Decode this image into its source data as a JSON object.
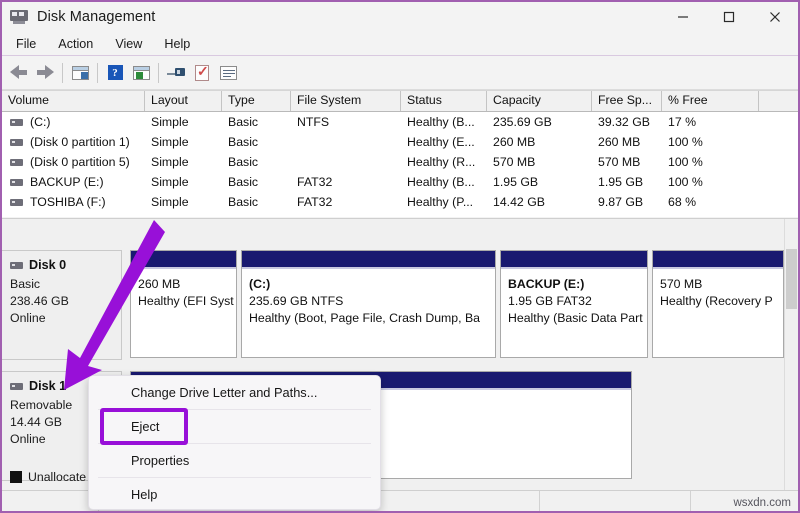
{
  "window": {
    "title": "Disk Management",
    "icon": "disk-management-icon",
    "controls": {
      "minimize": "minimize-icon",
      "maximize": "maximize-icon",
      "close": "close-icon"
    }
  },
  "menubar": {
    "items": [
      "File",
      "Action",
      "View",
      "Help"
    ]
  },
  "toolbar": {
    "buttons": [
      {
        "name": "back-icon"
      },
      {
        "name": "forward-icon"
      },
      {
        "name": "show-hide-console-tree-icon"
      },
      {
        "name": "help-icon"
      },
      {
        "name": "properties-window-icon"
      },
      {
        "name": "rescan-disks-icon"
      },
      {
        "name": "checklist-icon"
      },
      {
        "name": "list-view-icon"
      }
    ]
  },
  "volume_list": {
    "columns": [
      "Volume",
      "Layout",
      "Type",
      "File System",
      "Status",
      "Capacity",
      "Free Sp...",
      "% Free",
      ""
    ],
    "rows": [
      {
        "volume": "(C:)",
        "layout": "Simple",
        "type": "Basic",
        "file_system": "NTFS",
        "status": "Healthy (B...",
        "capacity": "235.69 GB",
        "free_space": "39.32 GB",
        "percent_free": "17 %"
      },
      {
        "volume": "(Disk 0 partition 1)",
        "layout": "Simple",
        "type": "Basic",
        "file_system": "",
        "status": "Healthy (E...",
        "capacity": "260 MB",
        "free_space": "260 MB",
        "percent_free": "100 %"
      },
      {
        "volume": "(Disk 0 partition 5)",
        "layout": "Simple",
        "type": "Basic",
        "file_system": "",
        "status": "Healthy (R...",
        "capacity": "570 MB",
        "free_space": "570 MB",
        "percent_free": "100 %"
      },
      {
        "volume": "BACKUP (E:)",
        "layout": "Simple",
        "type": "Basic",
        "file_system": "FAT32",
        "status": "Healthy (B...",
        "capacity": "1.95 GB",
        "free_space": "1.95 GB",
        "percent_free": "100 %"
      },
      {
        "volume": "TOSHIBA (F:)",
        "layout": "Simple",
        "type": "Basic",
        "file_system": "FAT32",
        "status": "Healthy (P...",
        "capacity": "14.42 GB",
        "free_space": "9.87 GB",
        "percent_free": "68 %"
      }
    ]
  },
  "graphical_view": {
    "disks": [
      {
        "name": "Disk 0",
        "type": "Basic",
        "size": "238.46 GB",
        "state": "Online",
        "partitions": [
          {
            "label": "",
            "size_fs": "260 MB",
            "status": "Healthy (EFI Syst"
          },
          {
            "label": "(C:)",
            "size_fs": "235.69 GB NTFS",
            "status": "Healthy (Boot, Page File, Crash Dump, Ba"
          },
          {
            "label": "BACKUP  (E:)",
            "size_fs": "1.95 GB FAT32",
            "status": "Healthy (Basic Data Part"
          },
          {
            "label": "",
            "size_fs": "570 MB",
            "status": "Healthy (Recovery P"
          }
        ]
      },
      {
        "name": "Disk 1",
        "type": "Removable",
        "size": "14.44 GB",
        "state": "Online",
        "partitions": [
          {
            "label": "",
            "size_fs": "",
            "status": ""
          }
        ]
      }
    ],
    "legend": {
      "label": "Unallocate"
    }
  },
  "context_menu": {
    "items": [
      {
        "label": "Change Drive Letter and Paths...",
        "highlighted": false
      },
      {
        "label": "Eject",
        "highlighted": true
      },
      {
        "label": "Properties",
        "highlighted": false
      },
      {
        "label": "Help",
        "highlighted": false
      }
    ],
    "highlight_color": "#9810d8"
  },
  "annotation": {
    "arrow_color": "#9810d8"
  },
  "watermark": {
    "text": "wsxdn.com"
  }
}
